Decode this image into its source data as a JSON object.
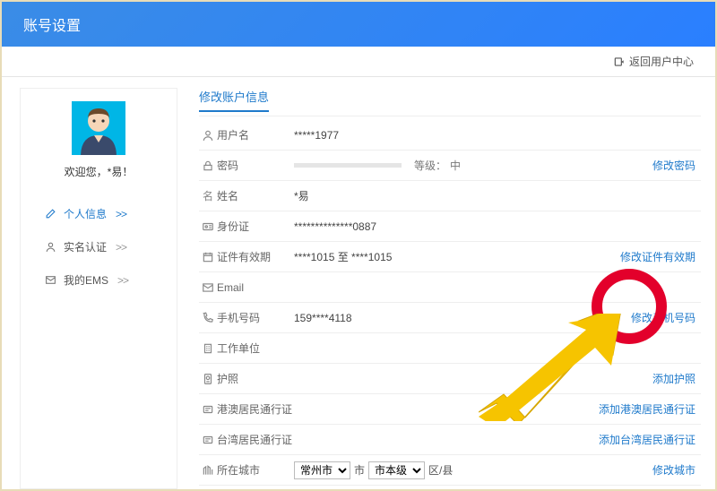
{
  "header": {
    "title": "账号设置"
  },
  "topbar": {
    "back": "返回用户中心"
  },
  "sidebar": {
    "welcome": "欢迎您，*易！",
    "items": [
      {
        "label": "个人信息",
        "arrows": ">>"
      },
      {
        "label": "实名认证",
        "arrows": ">>"
      },
      {
        "label": "我的EMS",
        "arrows": ">>"
      }
    ]
  },
  "main": {
    "section_title": "修改账户信息",
    "rows": {
      "username": {
        "label": "用户名",
        "value": "*****1977"
      },
      "password": {
        "label": "密码",
        "level_label": "等级：",
        "level_value": "中",
        "action": "修改密码"
      },
      "realname": {
        "label": "姓名",
        "value": "*易"
      },
      "idcard": {
        "label": "身份证",
        "value": "**************0887"
      },
      "idvalid": {
        "label": "证件有效期",
        "value": "****1015  至  ****1015",
        "action": "修改证件有效期"
      },
      "email": {
        "label": "Email",
        "value": ""
      },
      "mobile": {
        "label": "手机号码",
        "value": "159****4118",
        "action": "修改手机号码"
      },
      "work": {
        "label": "工作单位",
        "value": ""
      },
      "passport": {
        "label": "护照",
        "value": "",
        "action": "添加护照"
      },
      "hkmo": {
        "label": "港澳居民通行证",
        "value": "",
        "action": "添加港澳居民通行证"
      },
      "tw": {
        "label": "台湾居民通行证",
        "value": "",
        "action": "添加台湾居民通行证"
      },
      "city": {
        "label": "所在城市",
        "province": "常州市",
        "city_lbl": "市",
        "city_val": "市本级",
        "district_lbl": "区/县",
        "action": "修改城市"
      }
    }
  }
}
